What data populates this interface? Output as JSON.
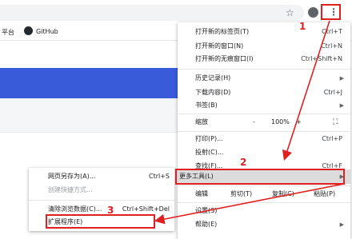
{
  "browser": {
    "bookmark_prefix": "平台",
    "bookmark_github": "GitHub"
  },
  "menu": {
    "new_tab": {
      "label": "打开新的标签页(T)",
      "shortcut": "Ctrl+T"
    },
    "new_window": {
      "label": "打开新的窗口(N)",
      "shortcut": "Ctrl+N"
    },
    "incognito": {
      "label": "打开新的无痕窗口(I)",
      "shortcut": "Ctrl+Shift+N"
    },
    "history": {
      "label": "历史记录(H)"
    },
    "downloads": {
      "label": "下载内容(D)",
      "shortcut": "Ctrl+J"
    },
    "bookmarks": {
      "label": "书签(B)"
    },
    "zoom": {
      "label": "缩放",
      "minus": "-",
      "value": "100%",
      "plus": "+"
    },
    "print": {
      "label": "打印(P)...",
      "shortcut": "Ctrl+P"
    },
    "cast": {
      "label": "投射(C)..."
    },
    "find": {
      "label": "查找(F)...",
      "shortcut": "Ctrl+F"
    },
    "more_tools": {
      "label": "更多工具(L)"
    },
    "edit": {
      "label": "编辑",
      "cut": "剪切(T)",
      "copy": "复制(C)",
      "paste": "粘贴(P)"
    },
    "settings": {
      "label": "设置(S)"
    },
    "help": {
      "label": "帮助(E)"
    }
  },
  "submenu": {
    "save_page": {
      "label": "网页另存为(A)...",
      "shortcut": "Ctrl+S"
    },
    "create_shortcut": {
      "label": "创建快捷方式..."
    },
    "clear_data": {
      "label": "清除浏览数据(C)...",
      "shortcut": "Ctrl+Shift+Del"
    },
    "extensions": {
      "label": "扩展程序(E)"
    }
  },
  "annotations": {
    "step1": "1",
    "step2": "2",
    "step3": "3"
  },
  "colors": {
    "accent_red": "#e02020",
    "page_blue": "#3a5bd9"
  }
}
